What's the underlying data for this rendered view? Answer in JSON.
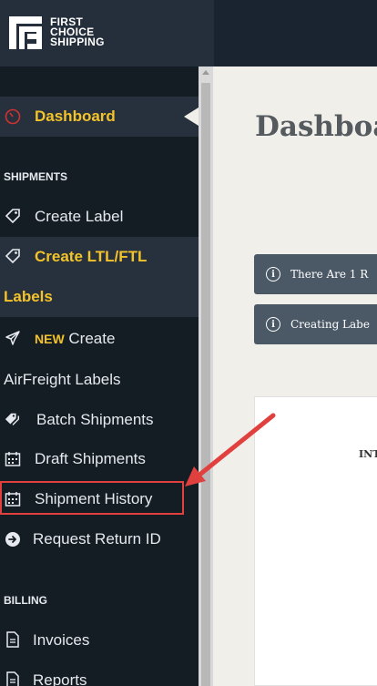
{
  "brand": {
    "lines": [
      "FIRST",
      "CHOICE",
      "SHIPPING"
    ]
  },
  "sidebar": {
    "dashboard": {
      "label": "Dashboard",
      "icon": "speedometer-icon"
    },
    "sections": {
      "shipments": "SHIPMENTS",
      "billing": "BILLING"
    },
    "items": [
      {
        "label": "Create Label",
        "icon": "tag-icon"
      },
      {
        "label": "Create LTL/FTL",
        "label2": "Labels",
        "icon": "tag-icon"
      },
      {
        "badge": "NEW",
        "label": "Create",
        "label2": "AirFreight Labels",
        "icon": "plane-icon"
      },
      {
        "label": "Batch Shipments",
        "icon": "tags-icon"
      },
      {
        "label": "Draft Shipments",
        "icon": "calendar-icon"
      },
      {
        "label": "Shipment History",
        "icon": "calendar-icon"
      },
      {
        "label": "Request Return ID",
        "icon": "arrow-circle-icon"
      }
    ],
    "billing_items": [
      {
        "label": "Invoices",
        "icon": "document-icon"
      },
      {
        "label": "Reports",
        "icon": "document-icon"
      }
    ]
  },
  "main": {
    "title": "Dashboa",
    "alerts": [
      {
        "icon": "i",
        "text": "There Are 1 R"
      },
      {
        "icon": "i",
        "text": "Creating Labe"
      }
    ],
    "card_text": "INT"
  },
  "colors": {
    "accent": "#f4c329",
    "sidebar": "#141c24",
    "annotation": "#e0403e"
  }
}
